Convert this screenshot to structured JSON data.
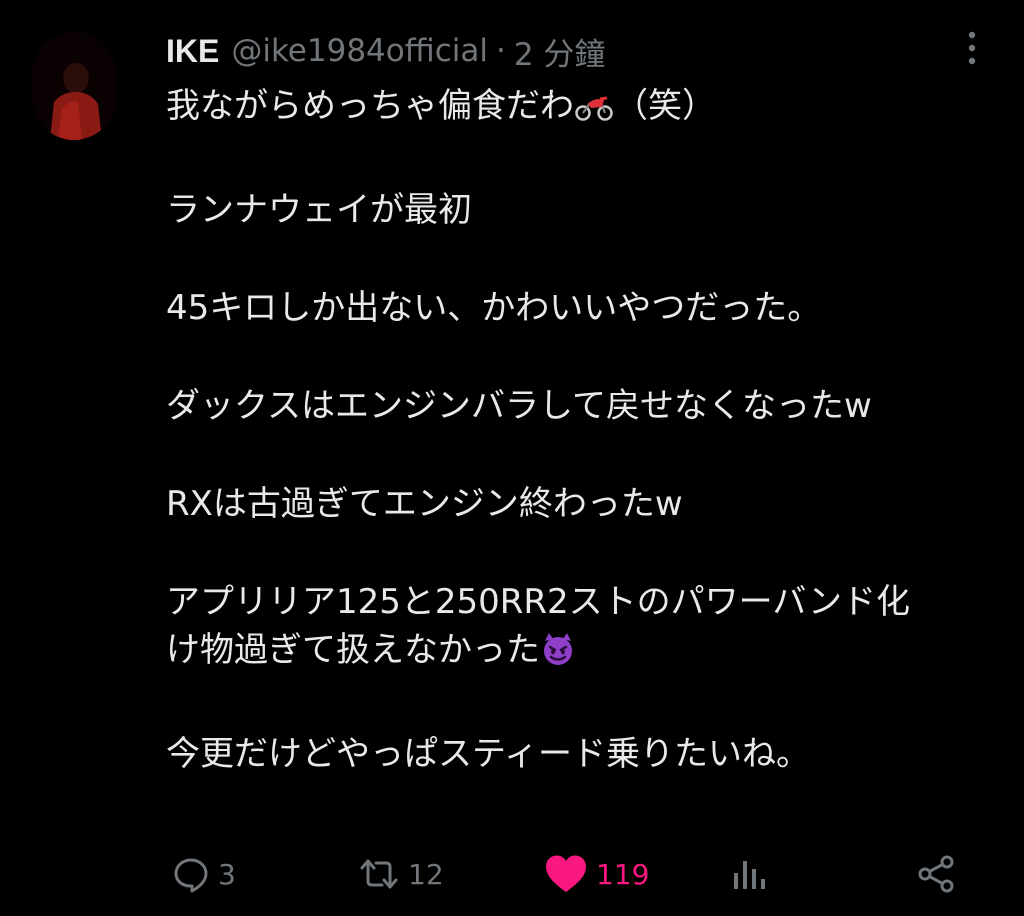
{
  "author": {
    "display_name": "IKE",
    "handle": "@ike1984official",
    "separator": "·",
    "time": "2 分鐘"
  },
  "tweet": {
    "lines": [
      "我ながらめっちゃ偏食だわ",
      "（笑）",
      "ランナウェイが最初",
      "45キロしか出ない、かわいいやつだった。",
      "ダックスはエンジンバラして戻せなくなったw",
      "RXは古過ぎてエンジン終わったw",
      "アプリリア125と250RR2ストのパワーバンド化",
      "け物過ぎて扱えなかった",
      "今更だけどやっぱスティード乗りたいね。"
    ]
  },
  "actions": {
    "reply_count": "3",
    "retweet_count": "12",
    "like_count": "119"
  },
  "icons": {
    "reply": "reply-icon",
    "retweet": "retweet-icon",
    "like": "heart-icon",
    "views": "analytics-icon",
    "share": "share-icon",
    "more": "more-dots-icon",
    "motorcycle_emoji": "motorcycle-emoji",
    "devil_emoji": "smiling-devil-emoji"
  },
  "colors": {
    "background": "#000000",
    "text": "#e7e9ea",
    "secondary": "#71767b",
    "like": "#f91880",
    "devil_emoji": "#8e3ec9"
  }
}
